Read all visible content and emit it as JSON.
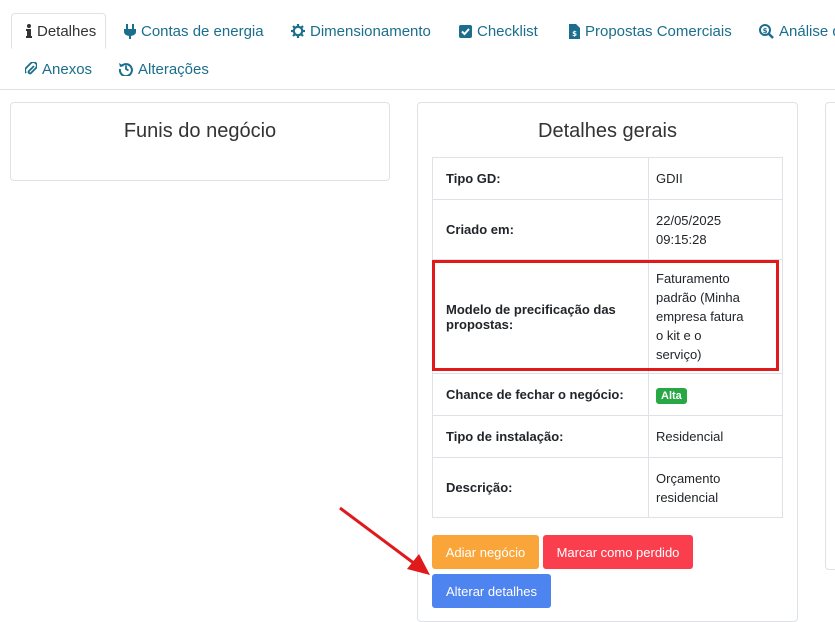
{
  "tabs": [
    {
      "label": "Detalhes",
      "icon": "info-icon",
      "active": true
    },
    {
      "label": "Contas de energia",
      "icon": "plug-icon"
    },
    {
      "label": "Dimensionamento",
      "icon": "gear-icon"
    },
    {
      "label": "Checklist",
      "icon": "checkbox-icon"
    },
    {
      "label": "Propostas Comerciais",
      "icon": "file-invoice-icon"
    },
    {
      "label": "Análise d",
      "icon": "search-dollar-icon"
    },
    {
      "label": "Anexos",
      "icon": "paperclip-icon"
    },
    {
      "label": "Alterações",
      "icon": "history-icon"
    }
  ],
  "funnels_card": {
    "title": "Funis do negócio"
  },
  "details_card": {
    "title": "Detalhes gerais",
    "rows": [
      {
        "key": "Tipo GD:",
        "value": "GDII"
      },
      {
        "key": "Criado em:",
        "value_lines": [
          "22/05/2025",
          "09:15:28"
        ]
      },
      {
        "key_lines": [
          "Modelo de precificação das",
          "propostas:"
        ],
        "value_lines": [
          "Faturamento",
          "padrão (Minha",
          "empresa fatura",
          "o kit e o",
          "serviço)"
        ]
      },
      {
        "key": "Chance de fechar o negócio:",
        "badge": "Alta"
      },
      {
        "key": "Tipo de instalação:",
        "value": "Residencial"
      },
      {
        "key": "Descrição:",
        "value_lines": [
          "Orçamento",
          "residencial"
        ]
      }
    ],
    "buttons": {
      "postpone": "Adiar negócio",
      "mark_lost": "Marcar como perdido",
      "edit_details": "Alterar detalhes"
    }
  },
  "colors": {
    "tab_link": "#1b6e8c",
    "postpone": "#f9a53a",
    "mark_lost": "#fa3e4d",
    "edit_details": "#4e84f0",
    "badge_success": "#28a745",
    "highlight": "#e0191b",
    "arrow": "#e0191b"
  }
}
